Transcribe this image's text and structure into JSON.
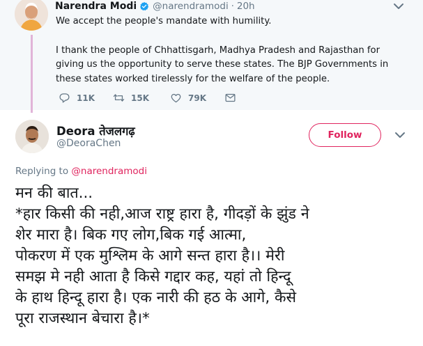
{
  "parent_tweet": {
    "author_name": "Narendra Modi",
    "author_handle": "@narendramodi",
    "time": "20h",
    "paragraphs": [
      "We accept the people's mandate with humility.",
      "I thank the people of Chhattisgarh, Madhya Pradesh and Rajasthan for giving us the opportunity to serve these states. The BJP Governments in these states worked tirelessly for the welfare of the people."
    ],
    "reply_count": "11K",
    "retweet_count": "15K",
    "like_count": "79K"
  },
  "main_tweet": {
    "author_name": "Deora तेजलगढ़",
    "author_handle": "@DeoraChen",
    "follow_label": "Follow",
    "replying_to_prefix": "Replying to ",
    "replying_to_handle": "@narendramodi",
    "lines": [
      "मन की बात...",
      "*हार किसी की नही,आज राष्ट्र हारा है, गीदड़ों के झुंड ने",
      "शेर मारा है। बिक गए लोग,बिक गई आत्मा,",
      "पोकरण में एक मुश्लिम के आगे सन्त हारा है।। मेरी",
      "समझ मे नही आता है किसे गद्दार कह, यहां तो हिन्दू",
      "के हाथ हिन्दू हारा है। एक नारी की हठ के आगे, कैसे",
      "पूरा राजस्थान बेचारा है।*"
    ]
  },
  "icons": [
    "verified-icon",
    "chevron-down-icon",
    "reply-icon",
    "retweet-icon",
    "like-icon",
    "direct-message-icon"
  ],
  "colors": {
    "accent": "#e0245e",
    "thread_line": "#e1b4d8",
    "muted": "#657786",
    "verified": "#1da1f2",
    "parent_bg": "#f5f8fa"
  }
}
